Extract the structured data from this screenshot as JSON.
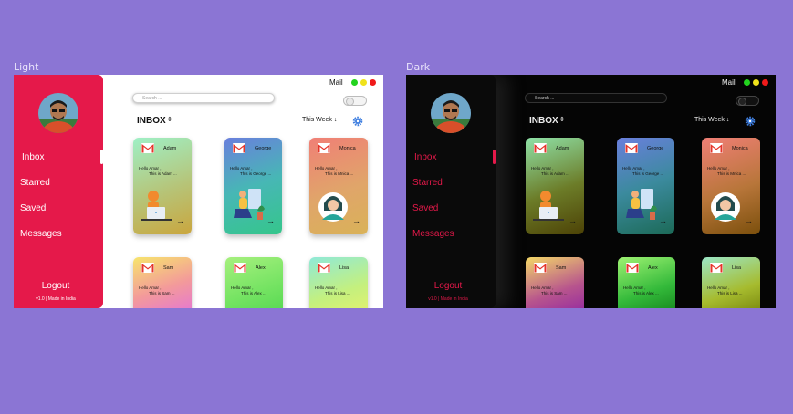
{
  "frames": {
    "light": {
      "label": "Light"
    },
    "dark": {
      "label": "Dark"
    }
  },
  "app": {
    "mail_title": "Mail",
    "search_placeholder": "Search ...",
    "inbox_title": "INBOX",
    "sort_icon": "⇕",
    "week_filter": "This Week ↓",
    "logout": "Logout",
    "version": "v1.0 | Made in India"
  },
  "nav": [
    {
      "label": "Inbox"
    },
    {
      "label": "Starred"
    },
    {
      "label": "Saved"
    },
    {
      "label": "Messages"
    }
  ],
  "window_dots": [
    "#22d31e",
    "#f0e21b",
    "#f01a1a"
  ],
  "cards": [
    {
      "name": "Adam",
      "greeting": "Hello  Amar ,",
      "preview": "This is Adam ...",
      "arrow": "→",
      "illustration": "person-laptop-icon",
      "light_gradient": "linear-gradient(160deg,#9ff0c6 0%,#b6c478 55%,#caa63e 100%)",
      "dark_gradient": "linear-gradient(160deg,#8fe2a8 0%,#6c7c28 55%,#4d4206 100%)"
    },
    {
      "name": "George",
      "greeting": "Hello  Amar ,",
      "preview": "This is George ...",
      "arrow": "→",
      "illustration": "person-plants-icon",
      "light_gradient": "linear-gradient(160deg,#6a7fdd 0%,#47b7b5 50%,#35c68b 100%)",
      "dark_gradient": "linear-gradient(160deg,#6a7fdd 0%,#3b8a9d 50%,#1c6a57 100%)"
    },
    {
      "name": "Monica",
      "greeting": "Hello  Amar ,",
      "preview": "This is Mnica ...",
      "arrow": "→",
      "illustration": "woman-avatar-icon",
      "light_gradient": "linear-gradient(160deg,#f07f76 0%,#e0a56a 55%,#d9b258 100%)",
      "dark_gradient": "linear-gradient(160deg,#f07f76 0%,#b8763a 55%,#7b4f0c 100%)"
    },
    {
      "name": "Sam",
      "greeting": "Hello  Amar ,",
      "preview": "This is Sam ...",
      "arrow": "→",
      "illustration": "",
      "light_gradient": "linear-gradient(160deg,#f7e56c 0%,#f39a9a 50%,#e26fe0 100%)",
      "dark_gradient": "linear-gradient(160deg,#f3d867 0%,#b7548d 55%,#8c1fa6 100%)"
    },
    {
      "name": "Alex",
      "greeting": "Hello  Amar ,",
      "preview": "This is Alex ...",
      "arrow": "→",
      "illustration": "",
      "light_gradient": "linear-gradient(160deg,#a6f07e 0%,#74e362 55%,#4fd64e 100%)",
      "dark_gradient": "linear-gradient(160deg,#9ef272 0%,#33b93a 55%,#0e7a16 100%)"
    },
    {
      "name": "Lisa",
      "greeting": "Hello  Amar ,",
      "preview": "This is Lisa ...",
      "arrow": "→",
      "illustration": "",
      "light_gradient": "linear-gradient(160deg,#8fe9d8 0%,#c4f07e 55%,#e9f26a 100%)",
      "dark_gradient": "linear-gradient(160deg,#9be7c7 0%,#a6bb2e 55%,#6d7a05 100%)"
    }
  ],
  "colors": {
    "accent": "#e5194a",
    "background": "#8b75d4",
    "gear": "#3f7fe0"
  }
}
